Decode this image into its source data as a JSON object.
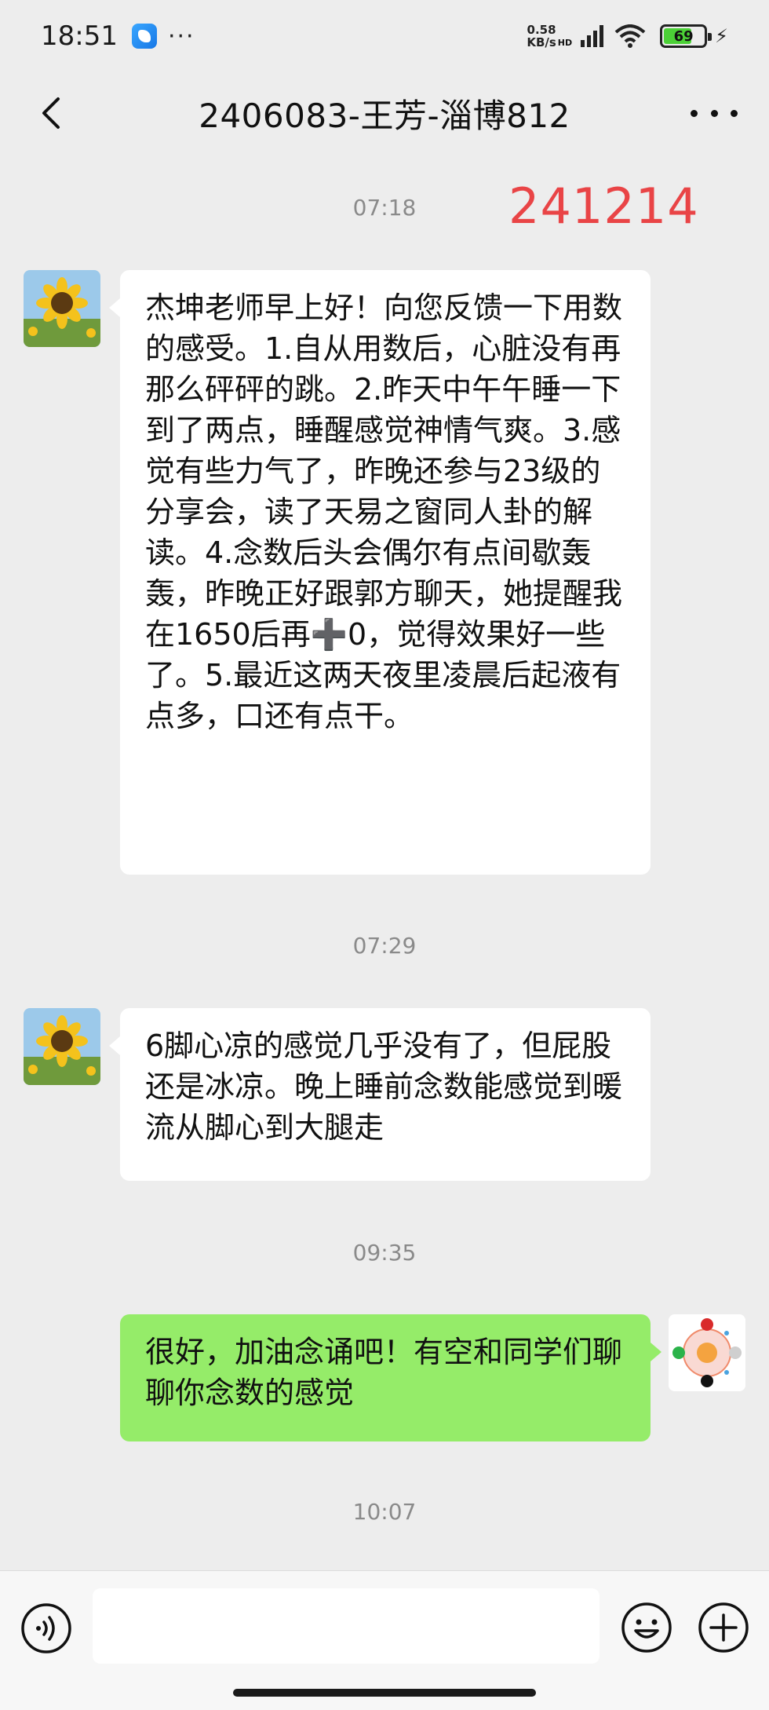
{
  "status_bar": {
    "time": "18:51",
    "more": "···",
    "net_speed_value": "0.58",
    "net_speed_unit": "KB/s",
    "hd": "HD",
    "battery": "69",
    "battery_level": 0.69
  },
  "header": {
    "title": "2406083-王芳-淄博812"
  },
  "annotation": "241214",
  "messages": [
    {
      "time": "07:18",
      "sender": "contact",
      "text": "杰坤老师早上好！向您反馈一下用数的感受。1.自从用数后，心脏没有再那么砰砰的跳。2.昨天中午午睡一下到了两点，睡醒感觉神情气爽。3.感觉有些力气了，昨晚还参与23级的分享会，读了天易之窗同人卦的解读。4.念数后头会偶尔有点间歇轰轰，昨晚正好跟郭方聊天，她提醒我在1650后再➕0，觉得效果好一些了。5.最近这两天夜里凌晨后起液有点多，口还有点干。"
    },
    {
      "time": "07:29",
      "sender": "contact",
      "text": "6脚心凉的感觉几乎没有了，但屁股还是冰凉。晚上睡前念数能感觉到暖流从脚心到大腿走"
    },
    {
      "time": "09:35",
      "sender": "me",
      "text": "很好，加油念诵吧！有空和同学们聊聊你念数的感觉"
    },
    {
      "time": "10:07"
    }
  ],
  "input_bar": {
    "placeholder": ""
  },
  "colors": {
    "background": "#ededed",
    "incoming_bubble": "#ffffff",
    "outgoing_bubble": "#95ec69",
    "annotation_red": "#e94446"
  }
}
